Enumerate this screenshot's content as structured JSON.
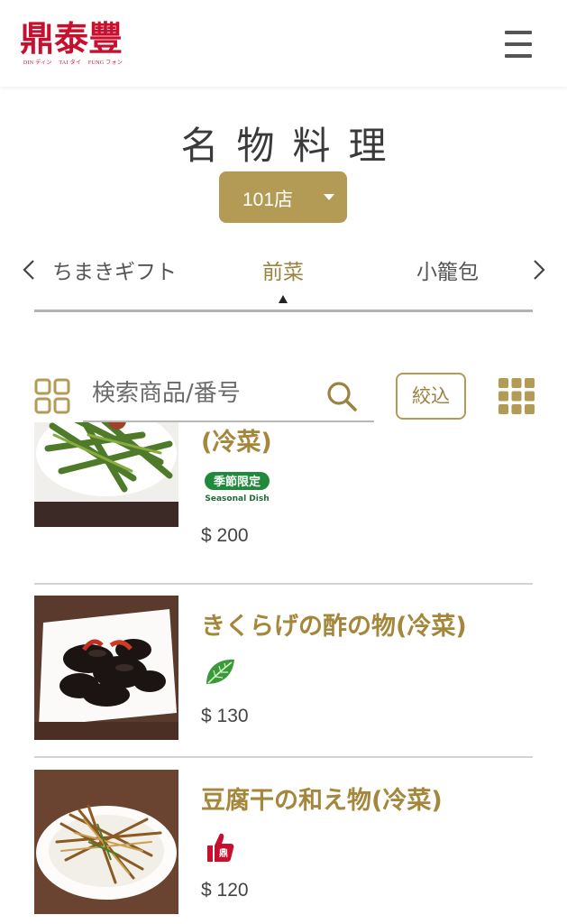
{
  "header": {
    "logo_chars": [
      "鼎",
      "泰",
      "豐"
    ],
    "logo_sub": [
      "DIN ディン",
      "TAI タイ",
      "FUNG フォン"
    ],
    "menu_icon": "hamburger-menu-icon"
  },
  "page": {
    "title": "名物料理"
  },
  "store_select": {
    "value": "101店"
  },
  "categories": {
    "prev": "ちまきギフト",
    "active": "前菜",
    "next": "小籠包"
  },
  "search": {
    "placeholder": "検索商品/番号",
    "filter_label": "絞込"
  },
  "products": [
    {
      "name": "(冷菜)",
      "badge": "seasonal-dish-badge",
      "badge_text": [
        "季節限定",
        "Seasonal Dish"
      ],
      "price": "$ 200"
    },
    {
      "name": "きくらげの酢の物(冷菜)",
      "badge": "vegetarian-leaf-icon",
      "price": "$ 130"
    },
    {
      "name": "豆腐干の和え物(冷菜)",
      "badge": "recommended-thumb-icon",
      "price": "$ 120"
    }
  ],
  "colors": {
    "gold": "#b39a55",
    "gold_text": "#a5873c",
    "brand_red": "#c8102e",
    "seasonal_green": "#1f8a3b"
  }
}
